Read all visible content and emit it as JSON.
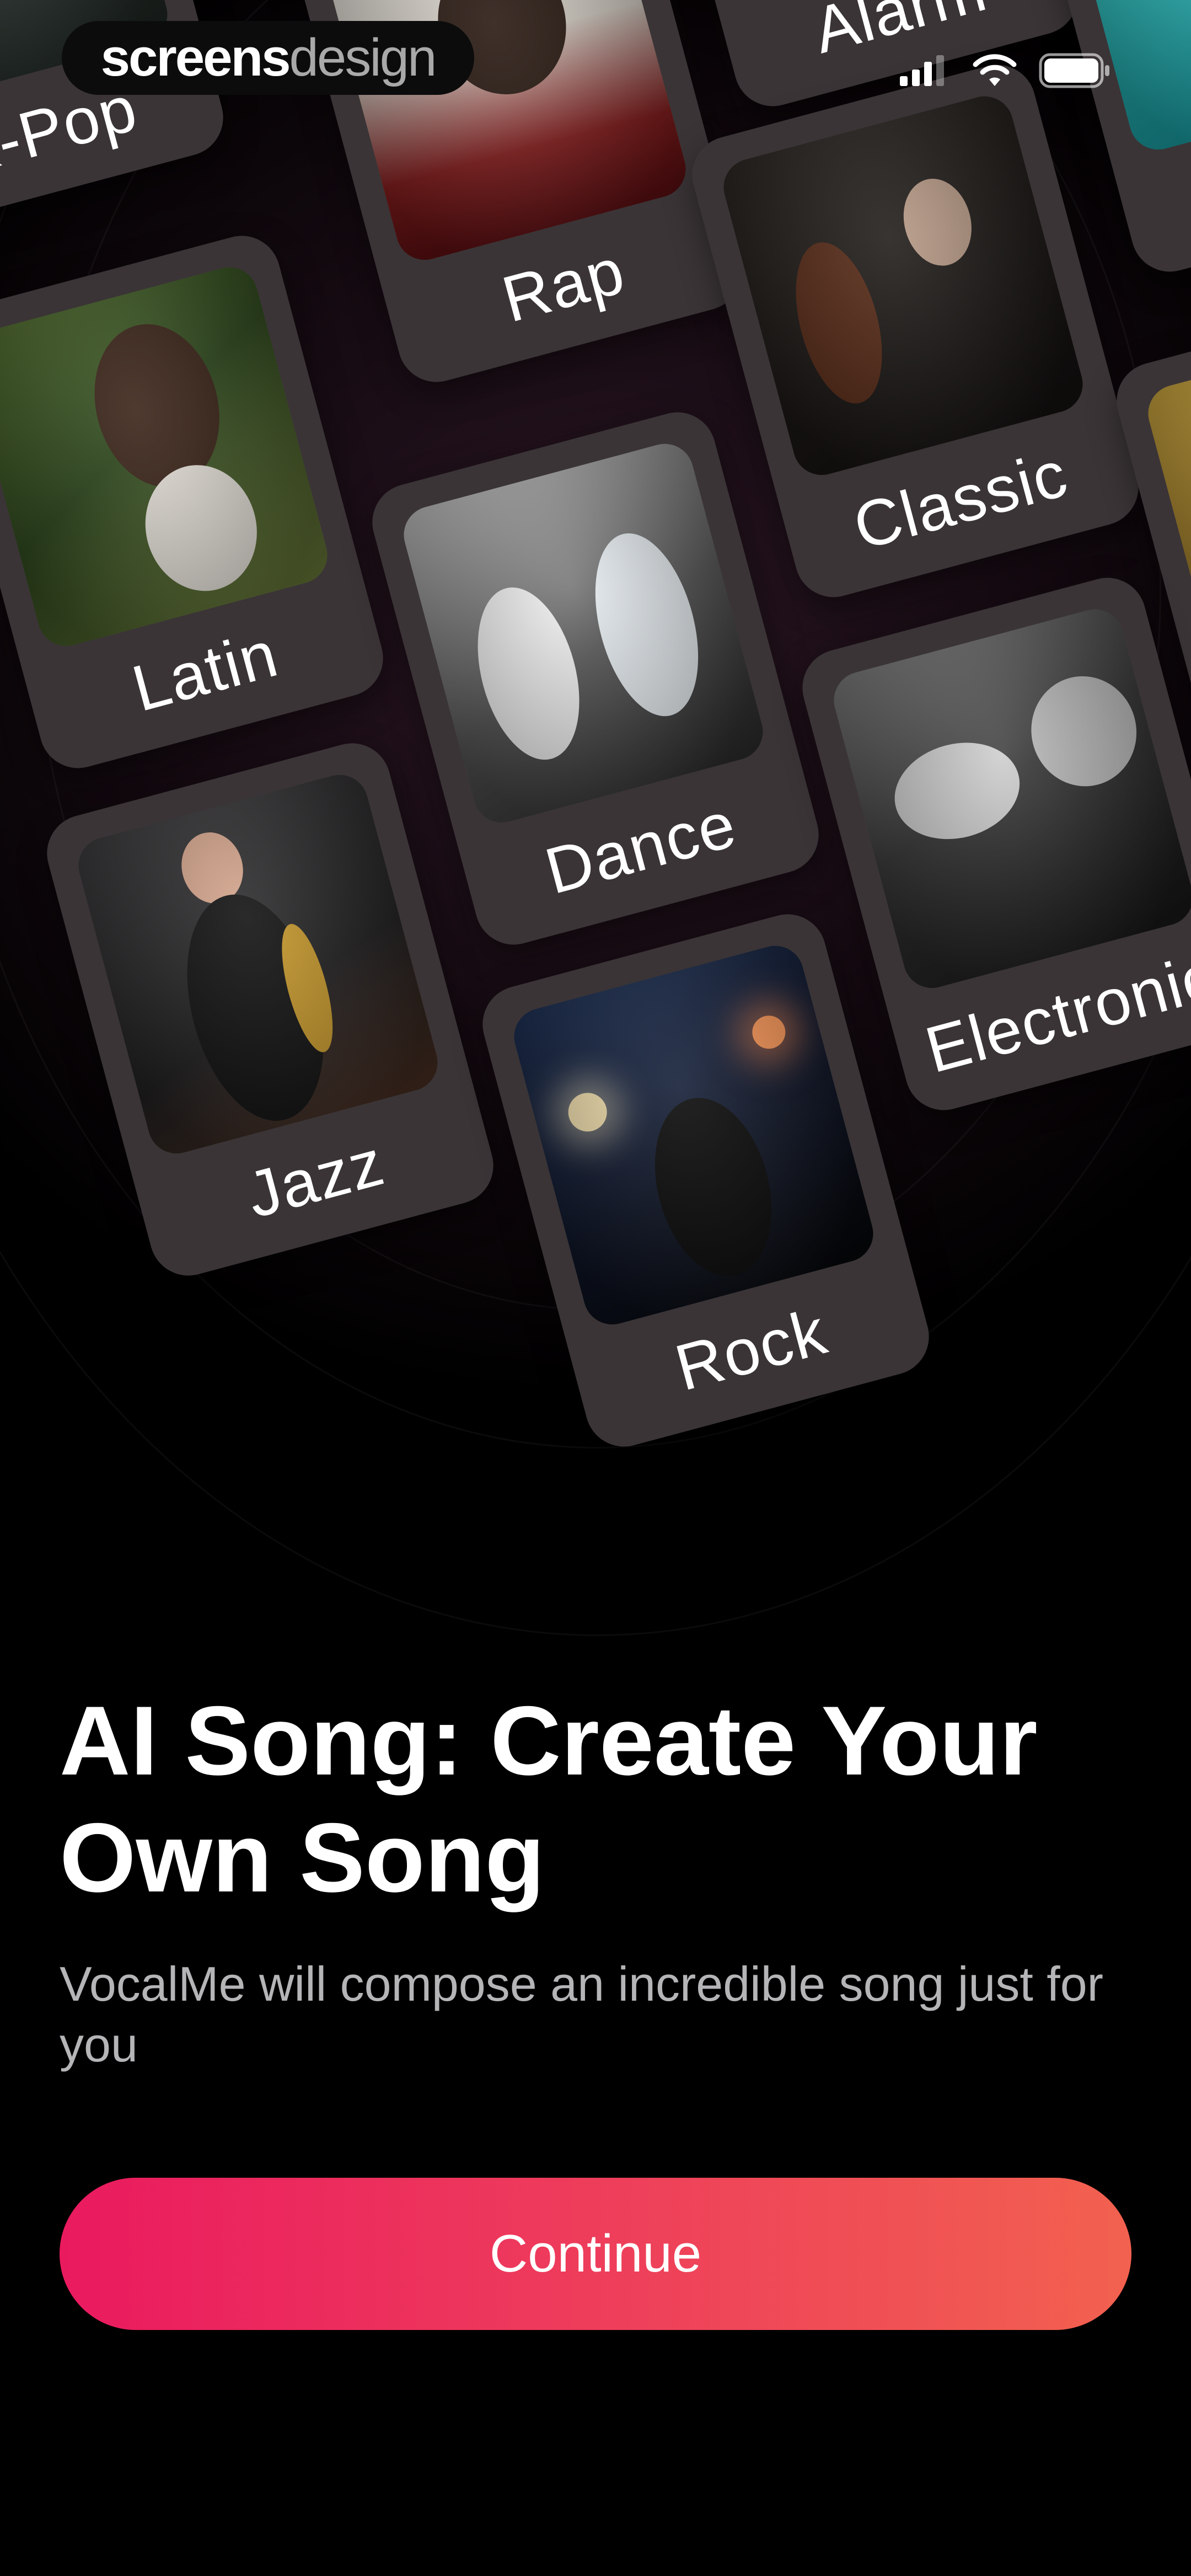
{
  "watermark": {
    "brand_part1": "screens",
    "brand_part2": "design"
  },
  "status_bar": {
    "signal_icon": "signal-icon",
    "wifi_icon": "wifi-icon",
    "battery_icon": "battery-icon"
  },
  "genres": {
    "kpop": "K-Pop",
    "rap": "Rap",
    "alarm": "Alarm",
    "latin": "Latin",
    "classic": "Classic",
    "dance": "Dance",
    "jazz": "Jazz",
    "electronic": "Electronic",
    "rock": "Rock"
  },
  "onboarding": {
    "title": "AI Song: Create Your Own Song",
    "subtitle": "VocalMe will compose an incredible song just for you",
    "continue_label": "Continue"
  },
  "colors": {
    "accent_start": "#ea1a5f",
    "accent_end": "#f2614f",
    "card_bg": "#3a3436",
    "background": "#000000"
  }
}
